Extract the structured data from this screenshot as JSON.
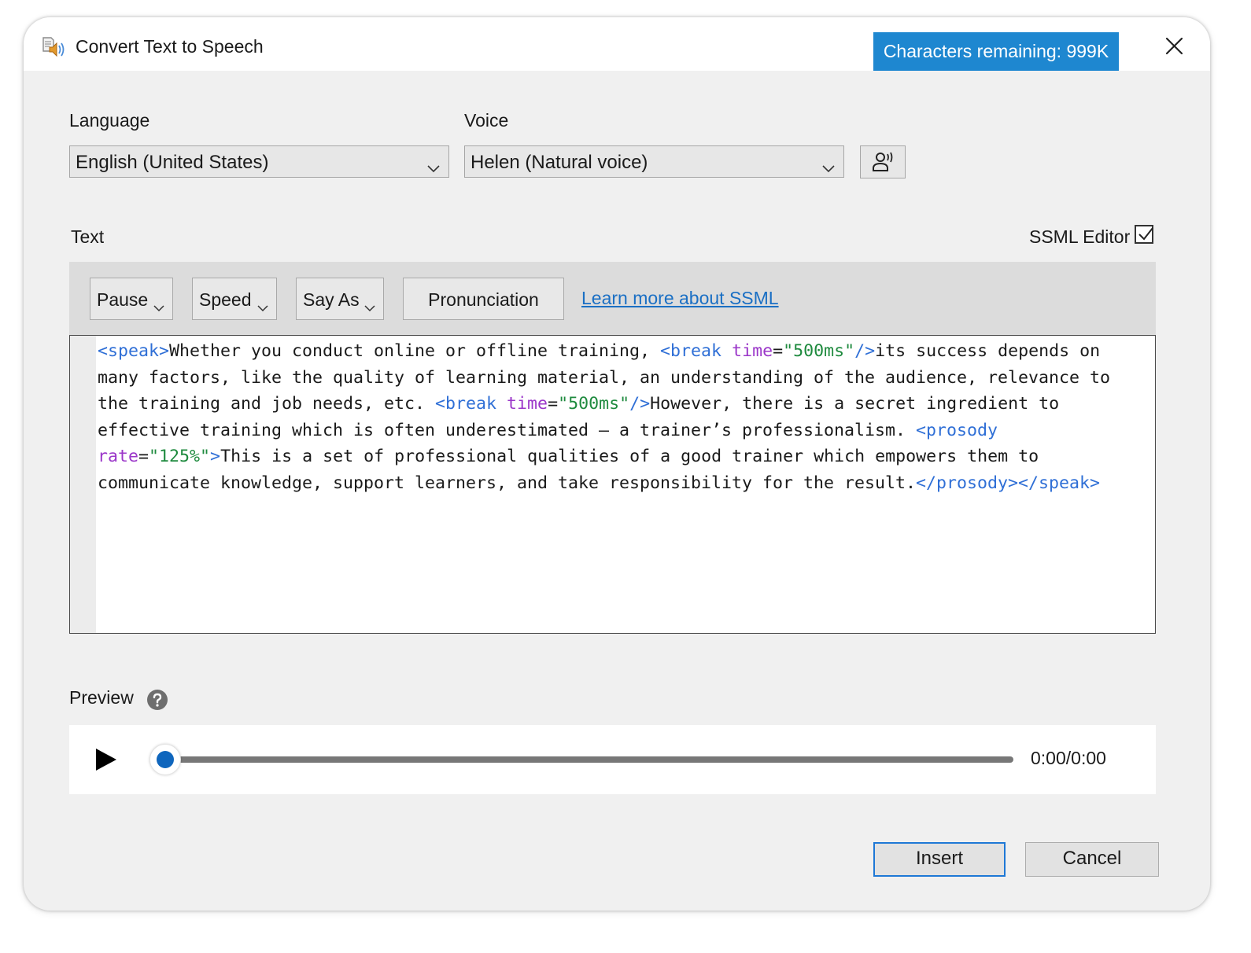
{
  "window": {
    "title": "Convert Text to Speech",
    "characters_remaining": "Characters remaining: 999K",
    "accent_color": "#1e87d0"
  },
  "language": {
    "label": "Language",
    "selected": "English (United States)"
  },
  "voice": {
    "label": "Voice",
    "selected": "Helen (Natural voice)"
  },
  "text_section": {
    "label": "Text",
    "ssml_editor_label": "SSML Editor",
    "ssml_editor_checked": true
  },
  "toolbar": {
    "pause": "Pause",
    "speed": "Speed",
    "say_as": "Say As",
    "pronunciation": "Pronunciation",
    "learn_more": "Learn more about SSML"
  },
  "editor": {
    "segments": [
      {
        "t": "<speak>",
        "c": "tag"
      },
      {
        "t": "Whether you conduct online or offline training, ",
        "c": ""
      },
      {
        "t": "<break ",
        "c": "tag"
      },
      {
        "t": "time",
        "c": "attr"
      },
      {
        "t": "=",
        "c": ""
      },
      {
        "t": "\"500ms\"",
        "c": "str"
      },
      {
        "t": "/>",
        "c": "tag"
      },
      {
        "t": "its success depends on many factors, like the quality of learning material, an understanding of the audience, relevance to the training and job needs, etc. ",
        "c": ""
      },
      {
        "t": "<break ",
        "c": "tag"
      },
      {
        "t": "time",
        "c": "attr"
      },
      {
        "t": "=",
        "c": ""
      },
      {
        "t": "\"500ms\"",
        "c": "str"
      },
      {
        "t": "/>",
        "c": "tag"
      },
      {
        "t": "However, there is a secret ingredient to effective training which is often underestimated – a trainer’s professionalism. ",
        "c": ""
      },
      {
        "t": "<prosody ",
        "c": "tag"
      },
      {
        "t": "rate",
        "c": "attr"
      },
      {
        "t": "=",
        "c": ""
      },
      {
        "t": "\"125%\"",
        "c": "str"
      },
      {
        "t": ">",
        "c": "tag"
      },
      {
        "t": "This is a set of professional qualities of a good trainer which empowers them to communicate knowledge, support learners, and take responsibility for the result.",
        "c": ""
      },
      {
        "t": "</prosody></speak>",
        "c": "tag"
      }
    ]
  },
  "preview": {
    "label": "Preview",
    "time": "0:00/0:00",
    "progress": 0.0
  },
  "buttons": {
    "insert": "Insert",
    "cancel": "Cancel"
  }
}
